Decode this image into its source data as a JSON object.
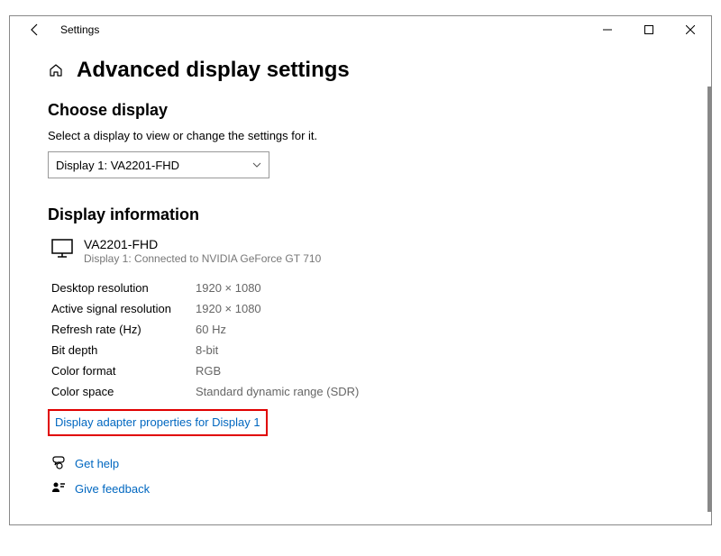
{
  "titlebar": {
    "title": "Settings"
  },
  "header": {
    "page_title": "Advanced display settings"
  },
  "choose_display": {
    "title": "Choose display",
    "hint": "Select a display to view or change the settings for it.",
    "selected": "Display 1: VA2201-FHD"
  },
  "display_info": {
    "title": "Display information",
    "monitor_name": "VA2201-FHD",
    "monitor_sub": "Display 1: Connected to NVIDIA GeForce GT 710",
    "rows": [
      {
        "label": "Desktop resolution",
        "value": "1920 × 1080"
      },
      {
        "label": "Active signal resolution",
        "value": "1920 × 1080"
      },
      {
        "label": "Refresh rate (Hz)",
        "value": "60 Hz"
      },
      {
        "label": "Bit depth",
        "value": "8-bit"
      },
      {
        "label": "Color format",
        "value": "RGB"
      },
      {
        "label": "Color space",
        "value": "Standard dynamic range (SDR)"
      }
    ],
    "adapter_link": "Display adapter properties for Display 1"
  },
  "help": {
    "get_help": "Get help",
    "give_feedback": "Give feedback"
  }
}
